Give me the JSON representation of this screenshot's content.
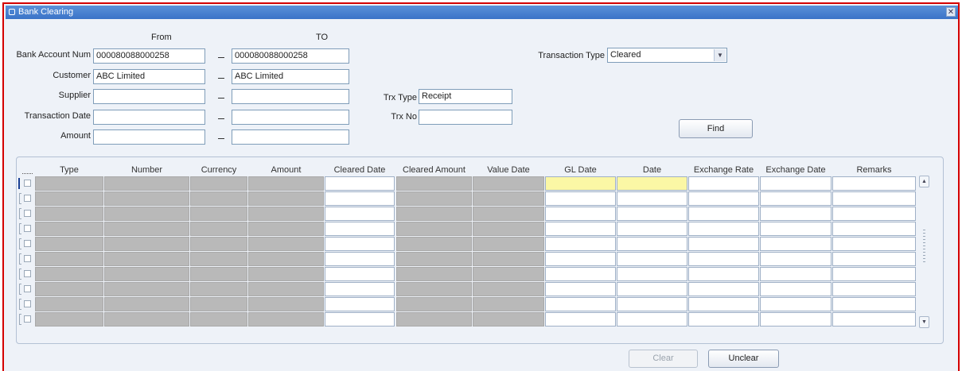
{
  "window": {
    "title": "Bank Clearing",
    "close_glyph": "✕"
  },
  "form": {
    "from_label": "From",
    "to_label": "TO",
    "bank_account_num": {
      "label": "Bank Account Num",
      "from": "000080088000258",
      "to": "000080088000258"
    },
    "customer": {
      "label": "Customer",
      "from": "ABC Limited",
      "to": "ABC Limited"
    },
    "supplier": {
      "label": "Supplier",
      "from": "",
      "to": ""
    },
    "transaction_date": {
      "label": "Transaction Date",
      "from": "",
      "to": ""
    },
    "amount": {
      "label": "Amount",
      "from": "",
      "to": ""
    },
    "transaction_type": {
      "label": "Transaction Type",
      "value": "Cleared"
    },
    "trx_type": {
      "label": "Trx Type",
      "value": "Receipt"
    },
    "trx_no": {
      "label": "Trx No",
      "value": ""
    },
    "find_label": "Find"
  },
  "grid": {
    "columns": [
      "Type",
      "Number",
      "Currency",
      "Amount",
      "Cleared Date",
      "Cleared Amount",
      "Value Date",
      "GL Date",
      "Date",
      "Exchange Rate",
      "Exchange Date",
      "Remarks"
    ],
    "column_kinds": [
      "ro",
      "ro",
      "ro",
      "ro",
      "ed",
      "ro",
      "ro",
      "ed",
      "ed",
      "ed",
      "ed",
      "ed"
    ],
    "row_count": 10,
    "current_row": 0,
    "current_row_highlight_columns": [
      7,
      8
    ],
    "colors": {
      "readonly": "#b9b9b9",
      "editable": "#ffffff",
      "current": "#fbf7a5"
    }
  },
  "actions": {
    "clear_label": "Clear",
    "unclear_label": "Unclear"
  },
  "icons": {
    "window": "app-icon",
    "close": "close-icon",
    "dropdown": "chevron-down-icon",
    "scroll_up": "scroll-up-icon",
    "scroll_down": "scroll-down-icon"
  }
}
